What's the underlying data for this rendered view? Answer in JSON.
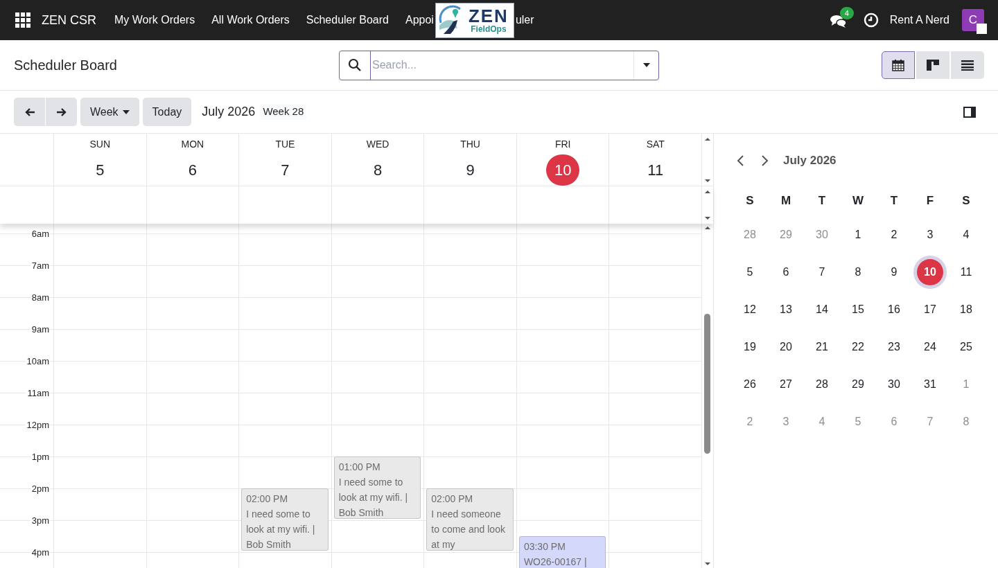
{
  "navbar": {
    "app_name": "ZEN CSR",
    "menu": [
      {
        "label": "My Work Orders"
      },
      {
        "label": "All Work Orders"
      },
      {
        "label": "Scheduler Board"
      }
    ],
    "partial_menu": {
      "label_before": "Appoi",
      "label_after": "uler"
    },
    "logo": {
      "title": "ZEN",
      "subtitle": "FieldOps"
    },
    "chat_count": "4",
    "company": "Rent A Nerd",
    "avatar": "C"
  },
  "control_panel": {
    "title": "Scheduler Board",
    "search": {
      "placeholder": "Search..."
    },
    "views": [
      {
        "kind": "calendar",
        "selected": true
      },
      {
        "kind": "kanban",
        "selected": false
      },
      {
        "kind": "list",
        "selected": false
      }
    ]
  },
  "toolbar": {
    "scale": "Week",
    "today": "Today",
    "period": "July 2026",
    "week": "Week 28"
  },
  "week": {
    "days": [
      {
        "name": "SUN",
        "date": "5",
        "today": false
      },
      {
        "name": "MON",
        "date": "6",
        "today": false
      },
      {
        "name": "TUE",
        "date": "7",
        "today": false,
        "events": [
          {
            "time": "02:00 PM",
            "text": "I need some to look at my wifi. | Bob Smith",
            "color": "#e9e9e9"
          }
        ]
      },
      {
        "name": "WED",
        "date": "8",
        "today": false,
        "events": [
          {
            "time": "01:00 PM",
            "text": "I need some to look at my wifi. | Bob Smith",
            "color": "#e9e9e9"
          }
        ]
      },
      {
        "name": "THU",
        "date": "9",
        "today": false,
        "events": [
          {
            "time": "02:00 PM",
            "text": "I need someone to come and look at my",
            "color": "#e9e9e9"
          }
        ]
      },
      {
        "name": "FRI",
        "date": "10",
        "today": true,
        "events": [
          {
            "time": "03:30 PM",
            "text": "WO26-00167 |",
            "color": "#d4d9fb"
          }
        ]
      },
      {
        "name": "SAT",
        "date": "11",
        "today": false
      }
    ],
    "hours": [
      "6am",
      "7am",
      "8am",
      "9am",
      "10am",
      "11am",
      "12pm",
      "1pm",
      "2pm",
      "3pm",
      "4pm"
    ]
  },
  "mini_calendar": {
    "title": "July 2026",
    "weekdays": [
      "S",
      "M",
      "T",
      "W",
      "T",
      "F",
      "S"
    ],
    "weeks": [
      [
        {
          "d": "28",
          "other_month": true,
          "selected": false
        },
        {
          "d": "29",
          "other_month": true,
          "selected": false
        },
        {
          "d": "30",
          "other_month": true,
          "selected": false
        },
        {
          "d": "1",
          "other_month": false,
          "selected": false
        },
        {
          "d": "2",
          "other_month": false,
          "selected": false
        },
        {
          "d": "3",
          "other_month": false,
          "selected": false
        },
        {
          "d": "4",
          "other_month": false,
          "selected": false
        }
      ],
      [
        {
          "d": "5",
          "other_month": false,
          "selected": false
        },
        {
          "d": "6",
          "other_month": false,
          "selected": false
        },
        {
          "d": "7",
          "other_month": false,
          "selected": false
        },
        {
          "d": "8",
          "other_month": false,
          "selected": false
        },
        {
          "d": "9",
          "other_month": false,
          "selected": false
        },
        {
          "d": "10",
          "other_month": false,
          "selected": true
        },
        {
          "d": "11",
          "other_month": false,
          "selected": false
        }
      ],
      [
        {
          "d": "12",
          "other_month": false,
          "selected": false
        },
        {
          "d": "13",
          "other_month": false,
          "selected": false
        },
        {
          "d": "14",
          "other_month": false,
          "selected": false
        },
        {
          "d": "15",
          "other_month": false,
          "selected": false
        },
        {
          "d": "16",
          "other_month": false,
          "selected": false
        },
        {
          "d": "17",
          "other_month": false,
          "selected": false
        },
        {
          "d": "18",
          "other_month": false,
          "selected": false
        }
      ],
      [
        {
          "d": "19",
          "other_month": false,
          "selected": false
        },
        {
          "d": "20",
          "other_month": false,
          "selected": false
        },
        {
          "d": "21",
          "other_month": false,
          "selected": false
        },
        {
          "d": "22",
          "other_month": false,
          "selected": false
        },
        {
          "d": "23",
          "other_month": false,
          "selected": false
        },
        {
          "d": "24",
          "other_month": false,
          "selected": false
        },
        {
          "d": "25",
          "other_month": false,
          "selected": false
        }
      ],
      [
        {
          "d": "26",
          "other_month": false,
          "selected": false
        },
        {
          "d": "27",
          "other_month": false,
          "selected": false
        },
        {
          "d": "28",
          "other_month": false,
          "selected": false
        },
        {
          "d": "29",
          "other_month": false,
          "selected": false
        },
        {
          "d": "30",
          "other_month": false,
          "selected": false
        },
        {
          "d": "31",
          "other_month": false,
          "selected": false
        },
        {
          "d": "1",
          "other_month": true,
          "selected": false
        }
      ],
      [
        {
          "d": "2",
          "other_month": true,
          "selected": false
        },
        {
          "d": "3",
          "other_month": true,
          "selected": false
        },
        {
          "d": "4",
          "other_month": true,
          "selected": false
        },
        {
          "d": "5",
          "other_month": true,
          "selected": false
        },
        {
          "d": "6",
          "other_month": true,
          "selected": false
        },
        {
          "d": "7",
          "other_month": true,
          "selected": false
        },
        {
          "d": "8",
          "other_month": true,
          "selected": false
        }
      ]
    ]
  }
}
